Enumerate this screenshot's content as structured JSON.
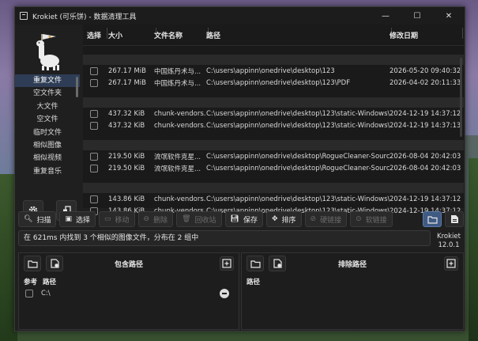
{
  "window": {
    "title": "Krokiet (可乐饼) - 数据清理工具"
  },
  "sidebar": {
    "items": [
      "重复文件",
      "空文件夹",
      "大文件",
      "空文件",
      "临时文件",
      "相似图像",
      "相似视频",
      "重复音乐"
    ],
    "active_index": 0
  },
  "table": {
    "headers": {
      "select": "选择",
      "size": "大小",
      "name": "文件名称",
      "path": "路径",
      "date": "修改日期"
    },
    "groups": [
      {
        "rows": [
          {
            "size": "267.17 MiB",
            "name": "中国炼丹术与...",
            "path": "C:\\users\\appinn\\onedrive\\desktop\\123",
            "date": "2026-05-20 09:40:32"
          },
          {
            "size": "267.17 MiB",
            "name": "中国炼丹术与...",
            "path": "C:\\users\\appinn\\onedrive\\desktop\\123\\PDF",
            "date": "2026-04-02 20:11:33"
          }
        ]
      },
      {
        "rows": [
          {
            "size": "437.32 KiB",
            "name": "chunk-vendors...",
            "path": "C:\\users\\appinn\\onedrive\\desktop\\123\\static-Windows\\js",
            "date": "2024-12-19 14:37:12"
          },
          {
            "size": "437.32 KiB",
            "name": "chunk-vendors...",
            "path": "C:\\users\\appinn\\onedrive\\desktop\\123\\static-Windows\\js",
            "date": "2024-12-19 14:37:13"
          }
        ]
      },
      {
        "rows": [
          {
            "size": "219.50 KiB",
            "name": "流氓软件克星...",
            "path": "C:\\users\\appinn\\onedrive\\desktop\\RogueCleaner-Source",
            "date": "2026-08-04 20:42:03"
          },
          {
            "size": "219.50 KiB",
            "name": "流氓软件克星...",
            "path": "C:\\users\\appinn\\onedrive\\desktop\\RogueCleaner-Source\\...",
            "date": "2026-08-04 20:42:03"
          }
        ]
      },
      {
        "rows": [
          {
            "size": "143.86 KiB",
            "name": "chunk-vendors...",
            "path": "C:\\users\\appinn\\onedrive\\desktop\\123\\static-Windows\\js",
            "date": "2024-12-19 14:37:12"
          },
          {
            "size": "143.86 KiB",
            "name": "chunk-vendors...",
            "path": "C:\\users\\appinn\\onedrive\\desktop\\123\\static-Windows\\js",
            "date": "2024-12-19 14:37:12"
          }
        ]
      }
    ]
  },
  "toolbar": {
    "scan": "扫描",
    "select": "选择",
    "move": "移动",
    "delete": "删除",
    "recycle": "回收站",
    "save": "保存",
    "sort": "排序",
    "hardlink": "硬链接",
    "symlink": "软链接"
  },
  "status": {
    "message": "在 621ms 内找到 3 个相似的图像文件，分布在 2 组中"
  },
  "version": {
    "name": "Krokiet",
    "number": "12.0.1"
  },
  "included": {
    "title": "包含路径",
    "col_ref": "参考",
    "col_path": "路径",
    "paths": [
      "C:\\"
    ]
  },
  "excluded": {
    "title": "排除路径",
    "col_path": "路径"
  }
}
